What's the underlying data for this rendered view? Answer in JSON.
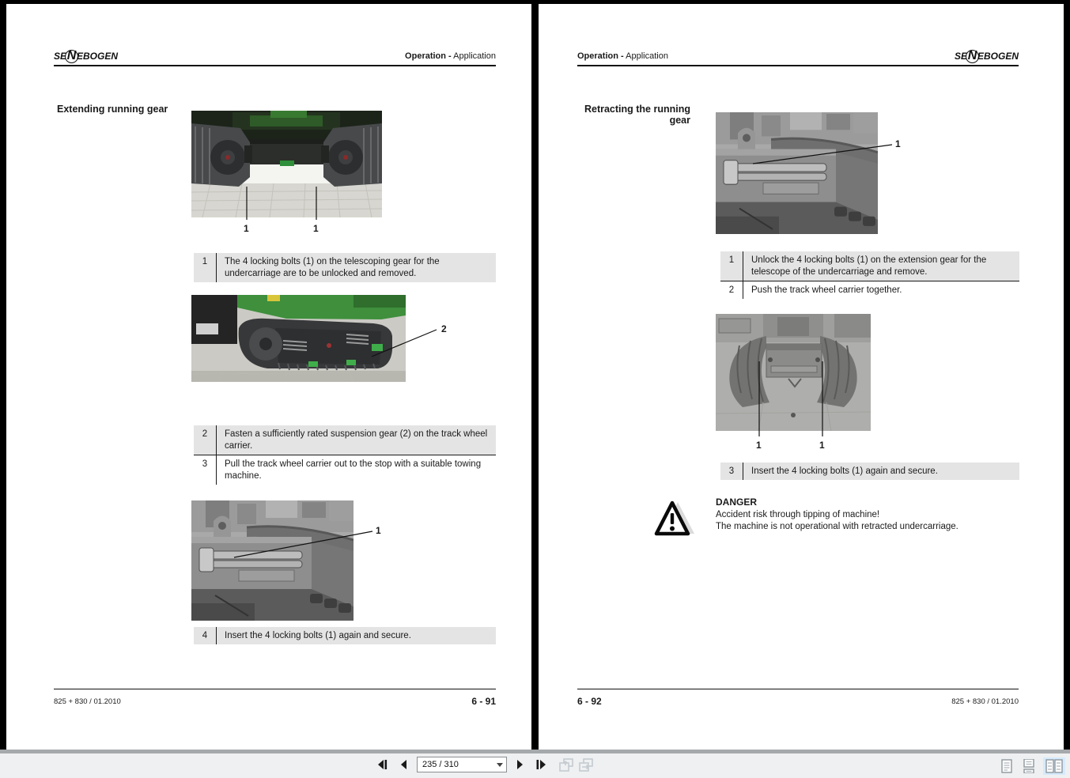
{
  "colors": {
    "canvas_bg": "#000000",
    "page_bg": "#ffffff",
    "step_row_gray": "#e4e4e4",
    "toolbar_bg": "#eff0f1",
    "selection_blue": "#d6eafc"
  },
  "toolbar": {
    "page_value": "235 / 310"
  },
  "left": {
    "logo": {
      "pre": "SE",
      "mid": "N",
      "post": "EBOGEN"
    },
    "header_bold": "Operation -",
    "header_regular": "Application",
    "heading": "Extending running gear",
    "figure1": {
      "labels": [
        "1",
        "1"
      ]
    },
    "table1": [
      {
        "num": "1",
        "text": "The 4 locking bolts (1) on the telescoping gear for the undercarriage are to be unlocked and removed."
      }
    ],
    "figure2": {
      "label": "2"
    },
    "table2": [
      {
        "num": "2",
        "text": "Fasten a sufficiently rated suspension gear (2) on the track wheel carrier."
      },
      {
        "num": "3",
        "text": "Pull the track wheel carrier out to the stop with a suitable towing machine."
      }
    ],
    "figure3": {
      "label": "1"
    },
    "table3": [
      {
        "num": "4",
        "text": "Insert the 4 locking bolts (1) again and secure."
      }
    ],
    "footer_left": "825 + 830 / 01.2010",
    "footer_right": "6 - 91"
  },
  "right": {
    "logo": {
      "pre": "SE",
      "mid": "N",
      "post": "EBOGEN"
    },
    "header_bold": "Operation -",
    "header_regular": "Application",
    "heading_line1": "Retracting the running",
    "heading_line2": "gear",
    "figure1": {
      "label": "1"
    },
    "table1": [
      {
        "num": "1",
        "text": "Unlock the 4 locking bolts (1) on the extension gear for the telescope of the undercarriage and remove."
      },
      {
        "num": "2",
        "text": "Push the track wheel carrier together."
      }
    ],
    "figure2": {
      "labels": [
        "1",
        "1"
      ]
    },
    "table2": [
      {
        "num": "3",
        "text": "Insert the 4 locking bolts (1) again and secure."
      }
    ],
    "danger": {
      "title": "DANGER",
      "line1": "Accident risk through tipping of machine!",
      "line2": "The machine is not operational with retracted undercarriage."
    },
    "footer_left": "6 - 92",
    "footer_right": "825 + 830 / 01.2010"
  }
}
